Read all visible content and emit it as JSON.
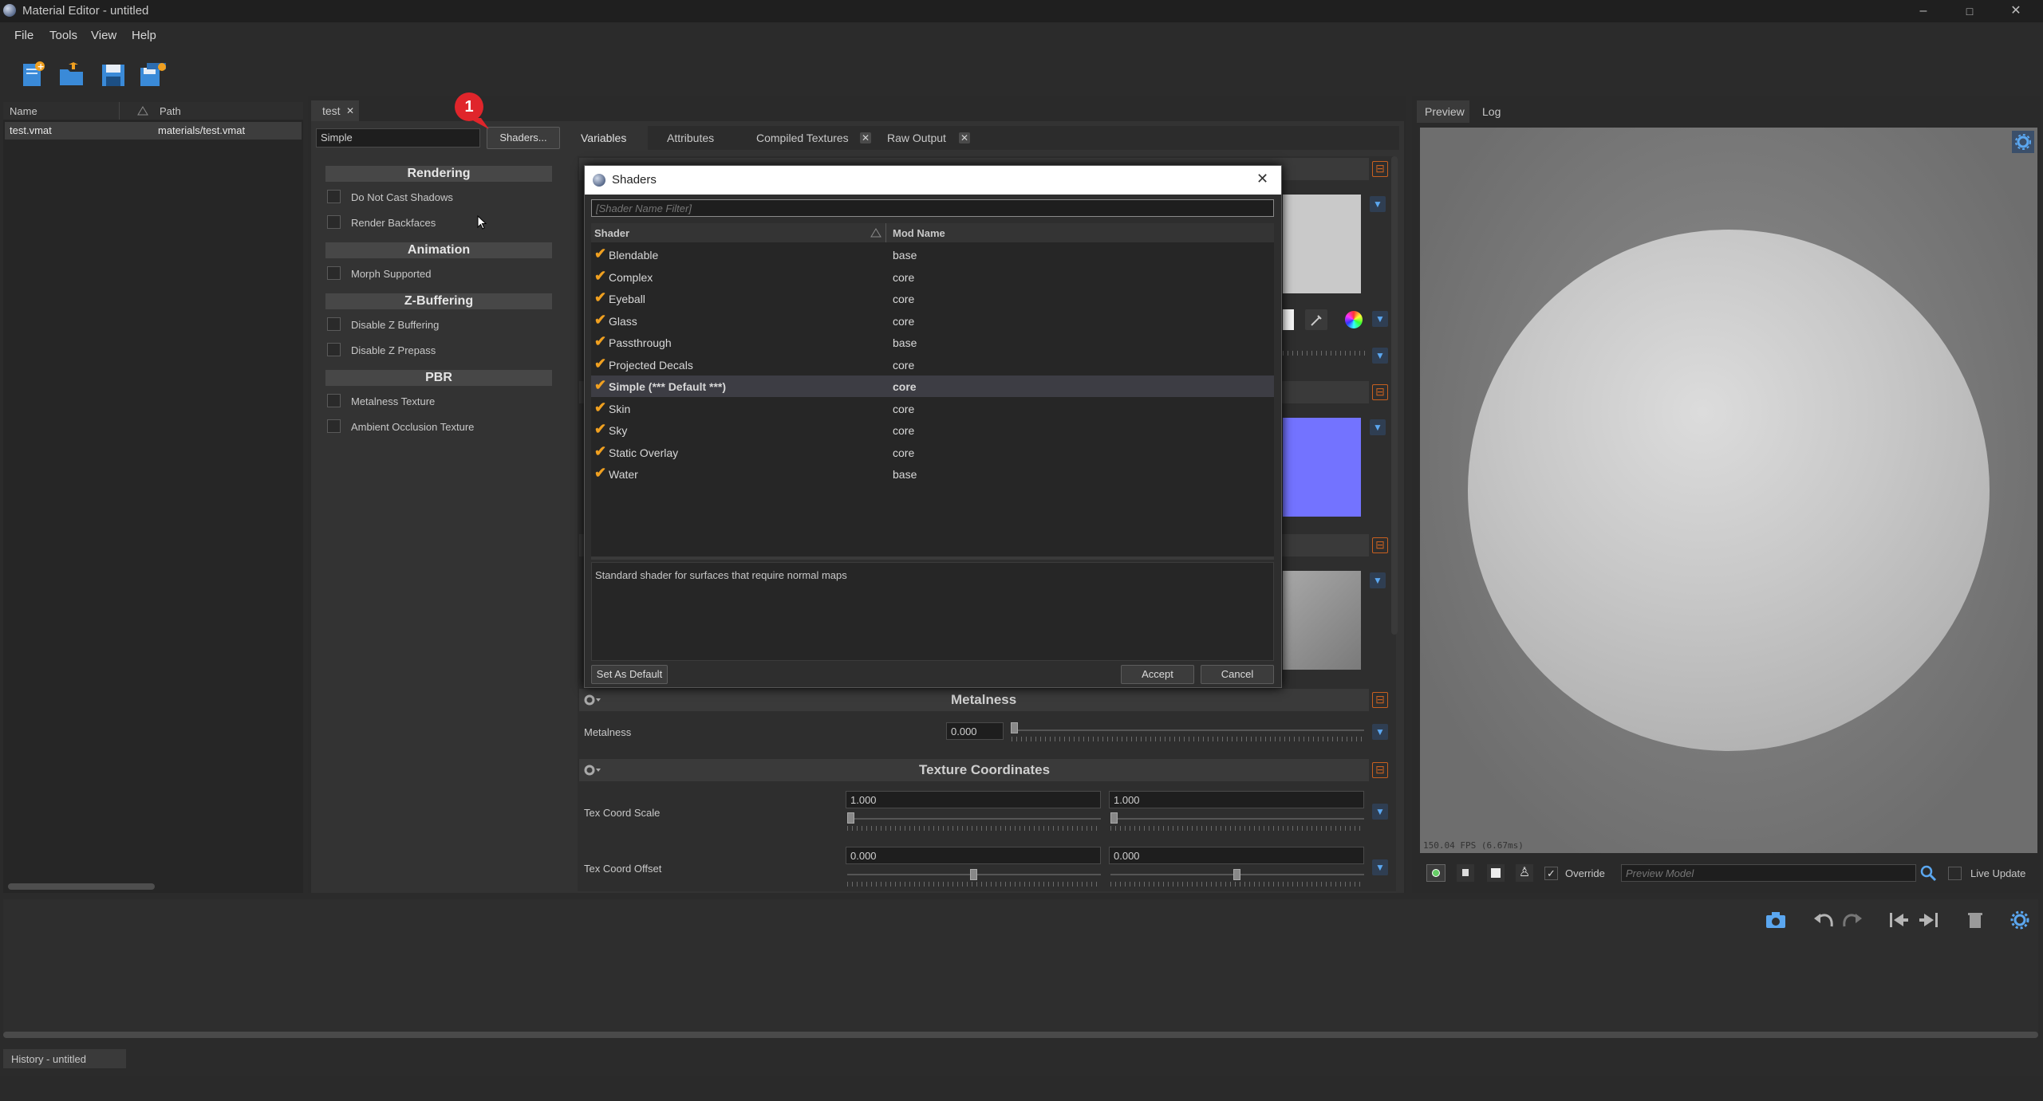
{
  "window": {
    "title": "Material Editor - untitled",
    "minimize": "–",
    "maximize": "□",
    "close": "✕"
  },
  "menu": [
    "File",
    "Tools",
    "View",
    "Help"
  ],
  "toolbar": {
    "icons": [
      "new-file-icon",
      "open-folder-icon",
      "save-icon",
      "save-all-icon"
    ]
  },
  "file_panel": {
    "col_name": "Name",
    "col_path": "Path",
    "rows": [
      {
        "name": "test.vmat",
        "path": "materials/test.vmat"
      }
    ]
  },
  "doc_tab": {
    "label": "test",
    "close": "✕"
  },
  "shader_field": {
    "value": "Simple",
    "button": "Shaders...",
    "badge": "1"
  },
  "feature_panel": {
    "sections": [
      {
        "title": "Rendering",
        "items": [
          "Do Not Cast Shadows",
          "Render Backfaces"
        ]
      },
      {
        "title": "Animation",
        "items": [
          "Morph Supported"
        ]
      },
      {
        "title": "Z-Buffering",
        "items": [
          "Disable Z Buffering",
          "Disable Z Prepass"
        ]
      },
      {
        "title": "PBR",
        "items": [
          "Metalness Texture",
          "Ambient Occlusion Texture"
        ]
      }
    ]
  },
  "var_tabs": {
    "variables": "Variables",
    "attributes": "Attributes",
    "compiled": "Compiled Textures",
    "raw": "Raw Output"
  },
  "metalness": {
    "section": "Metalness",
    "label": "Metalness",
    "value": "0.000"
  },
  "texcoord": {
    "section": "Texture Coordinates",
    "scale_label": "Tex Coord Scale",
    "scale_x": "1.000",
    "scale_y": "1.000",
    "offset_label": "Tex Coord Offset",
    "offset_x": "0.000",
    "offset_y": "0.000"
  },
  "dialog": {
    "title": "Shaders",
    "filter_placeholder": "[Shader Name Filter]",
    "col_shader": "Shader",
    "col_mod": "Mod Name",
    "rows": [
      {
        "shader": "Blendable",
        "mod": "base"
      },
      {
        "shader": "Complex",
        "mod": "core"
      },
      {
        "shader": "Eyeball",
        "mod": "core"
      },
      {
        "shader": "Glass",
        "mod": "core"
      },
      {
        "shader": "Passthrough",
        "mod": "base"
      },
      {
        "shader": "Projected Decals",
        "mod": "core"
      },
      {
        "shader": "Simple  (*** Default ***)",
        "mod": "core"
      },
      {
        "shader": "Skin",
        "mod": "core"
      },
      {
        "shader": "Sky",
        "mod": "core"
      },
      {
        "shader": "Static Overlay",
        "mod": "core"
      },
      {
        "shader": "Water",
        "mod": "base"
      }
    ],
    "description": "Standard shader for surfaces that require normal maps",
    "set_default": "Set As Default",
    "accept": "Accept",
    "cancel": "Cancel"
  },
  "preview": {
    "tab_preview": "Preview",
    "tab_log": "Log",
    "fps": "150.04 FPS (6.67ms)",
    "override": "Override",
    "model_placeholder": "Preview Model",
    "live_update": "Live Update"
  },
  "history": {
    "tab": "History - untitled"
  },
  "colors": {
    "accent": "#f0a020",
    "badge": "#e0252b",
    "blue_swatch": "#7373ff",
    "selection": "#3d3d44"
  }
}
